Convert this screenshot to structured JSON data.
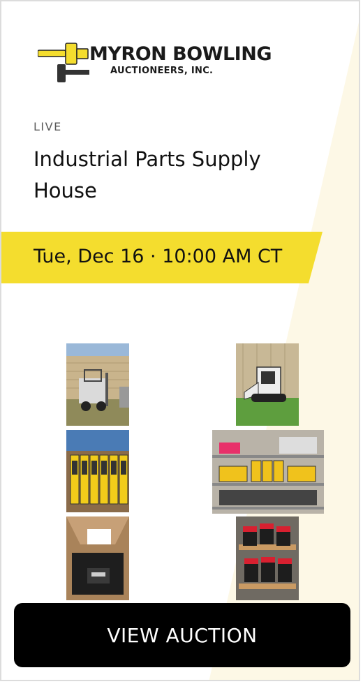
{
  "brand": {
    "line1": "MYRON BOWLING",
    "line2": "AUCTIONEERS, INC."
  },
  "auction": {
    "status": "LIVE",
    "title": "Industrial Parts Supply House",
    "datetime": "Tue, Dec 16 · 10:00 AM CT"
  },
  "photos": [
    {
      "name": "forklift"
    },
    {
      "name": "skid-steer"
    },
    {
      "name": "yellow-servo-drives"
    },
    {
      "name": "shelf-of-drives"
    },
    {
      "name": "boxed-controller"
    },
    {
      "name": "red-motors-pallet"
    }
  ],
  "cta": {
    "label": "VIEW AUCTION"
  },
  "colors": {
    "accent_yellow": "#f4dd2e",
    "wedge": "#fdf8e6",
    "button": "#000000"
  }
}
